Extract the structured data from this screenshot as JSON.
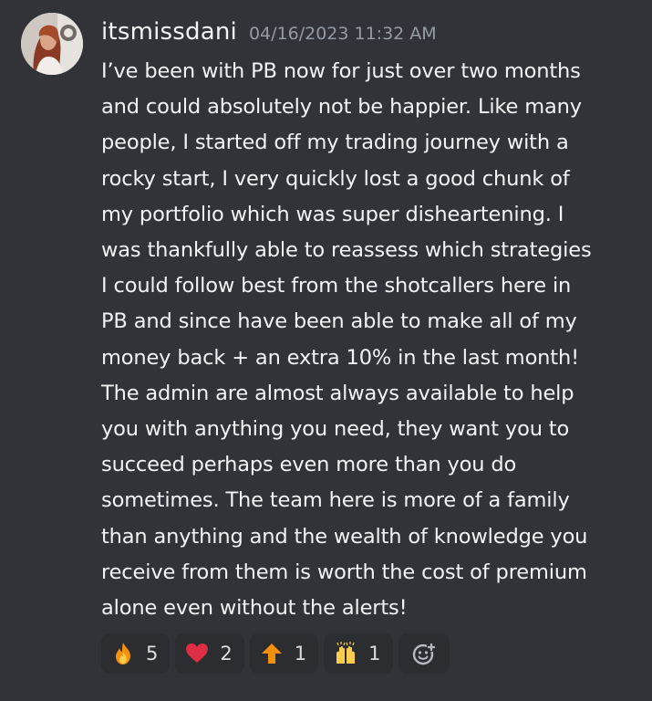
{
  "message": {
    "username": "itsmissdani",
    "timestamp": "04/16/2023 11:32 AM",
    "lines": [
      "I’ve been with PB now for just over two months",
      "and could absolutely not be happier. Like many",
      "people, I started off my trading journey with a",
      "rocky start, I very quickly lost a good chunk of",
      "my portfolio which was super disheartening. I",
      "was thankfully able to reassess which strategies",
      "I could follow best from the shotcallers here in",
      "PB and since have been able to make all of my",
      "money back + an extra 10% in the last month!",
      "The admin are almost always available to help",
      "you with anything you need, they want you to",
      "succeed perhaps even more than you do",
      "sometimes. The team here is more of a family",
      "than anything and the wealth of knowledge you",
      "receive from them is worth the cost of premium",
      "alone even without the alerts!"
    ]
  },
  "reactions": [
    {
      "icon": "fire-icon",
      "count": "5"
    },
    {
      "icon": "heart-icon",
      "count": "2"
    },
    {
      "icon": "up-arrow-icon",
      "count": "1"
    },
    {
      "icon": "raised-hands-icon",
      "count": "1"
    }
  ],
  "add_reaction_icon": "add-reaction-icon",
  "colors": {
    "background": "#313338",
    "text": "#f2f3f5",
    "timestamp": "#949ba4",
    "reaction_bg": "#2b2d31"
  }
}
